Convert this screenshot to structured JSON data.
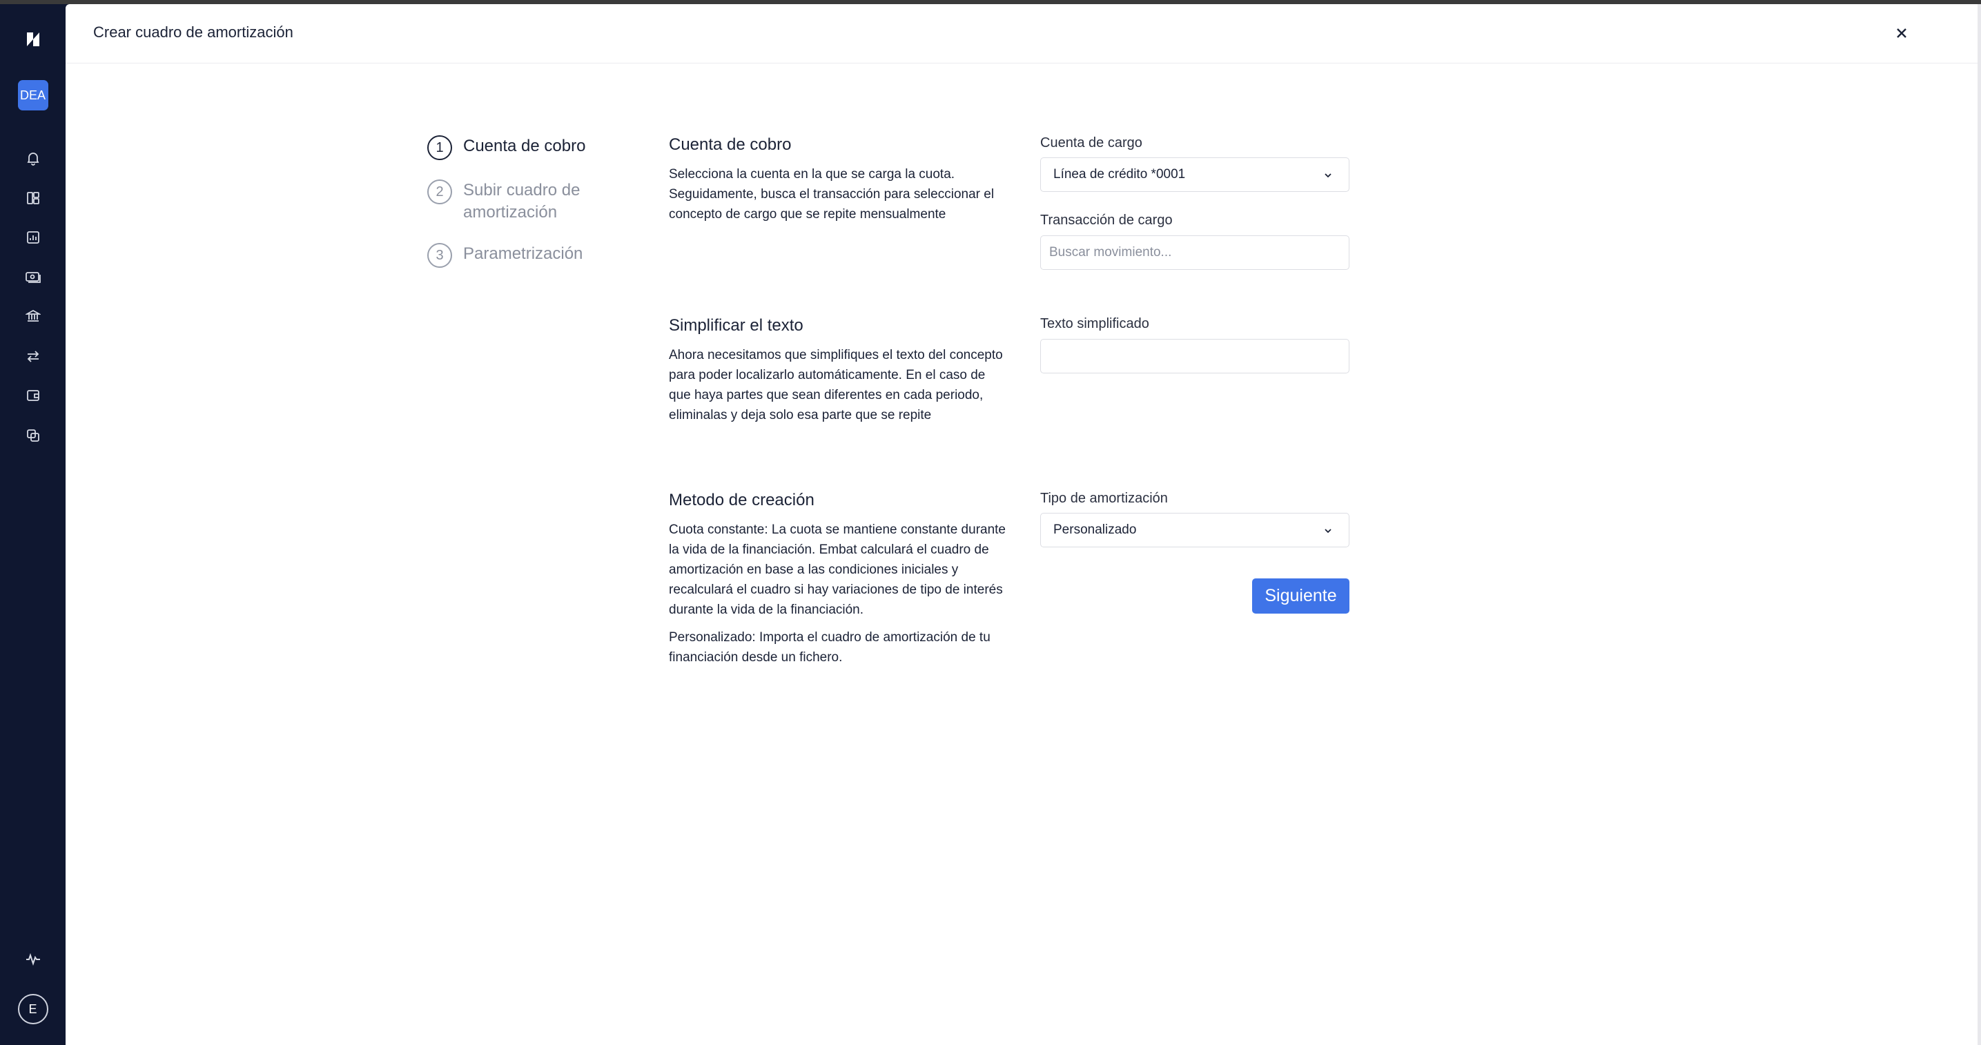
{
  "sidebar": {
    "org_badge": "DEA",
    "avatar_initial": "E",
    "icons": [
      "logo-icon",
      "bell-icon",
      "dashboard-icon",
      "chart-icon",
      "cash-icon",
      "bank-icon",
      "transfer-icon",
      "wallet-icon",
      "copy-icon",
      "activity-icon"
    ]
  },
  "modal": {
    "title": "Crear cuadro de amortización"
  },
  "steps": [
    {
      "number": "1",
      "label": "Cuenta de cobro",
      "active": true
    },
    {
      "number": "2",
      "label": "Subir cuadro de amortización",
      "active": false
    },
    {
      "number": "3",
      "label": "Parametrización",
      "active": false
    }
  ],
  "sections": {
    "cuenta": {
      "title": "Cuenta de cobro",
      "text": "Selecciona la cuenta en la que se carga la cuota. Seguidamente, busca el transacción para seleccionar el concepto de cargo que se repite mensualmente"
    },
    "simplificar": {
      "title": "Simplificar el texto",
      "text": "Ahora necesitamos que simplifiques el texto del concepto para poder localizarlo automáticamente. En el caso de que haya partes que sean diferentes en cada periodo, eliminalas y deja solo esa parte que se repite"
    },
    "metodo": {
      "title": "Metodo de creación",
      "text1": "Cuota constante: La cuota se mantiene constante durante la vida de la financiación. Embat calculará el cuadro de amortización en base a las condiciones iniciales y recalculará el cuadro si hay variaciones de tipo de interés durante la vida de la financiación.",
      "text2": "Personalizado: Importa el cuadro de amortización de tu financiación desde un fichero."
    }
  },
  "fields": {
    "cuenta_cargo": {
      "label": "Cuenta de cargo",
      "value": "Línea de crédito *0001"
    },
    "transaccion_cargo": {
      "label": "Transacción de cargo",
      "placeholder": "Buscar movimiento..."
    },
    "texto_simplificado": {
      "label": "Texto simplificado",
      "value": ""
    },
    "tipo_amortizacion": {
      "label": "Tipo de amortización",
      "value": "Personalizado"
    }
  },
  "actions": {
    "next_label": "Siguiente"
  },
  "colors": {
    "sidebar_bg": "#0f1730",
    "accent": "#3f74e8",
    "text": "#1b2236",
    "muted": "#8a8f9c"
  }
}
